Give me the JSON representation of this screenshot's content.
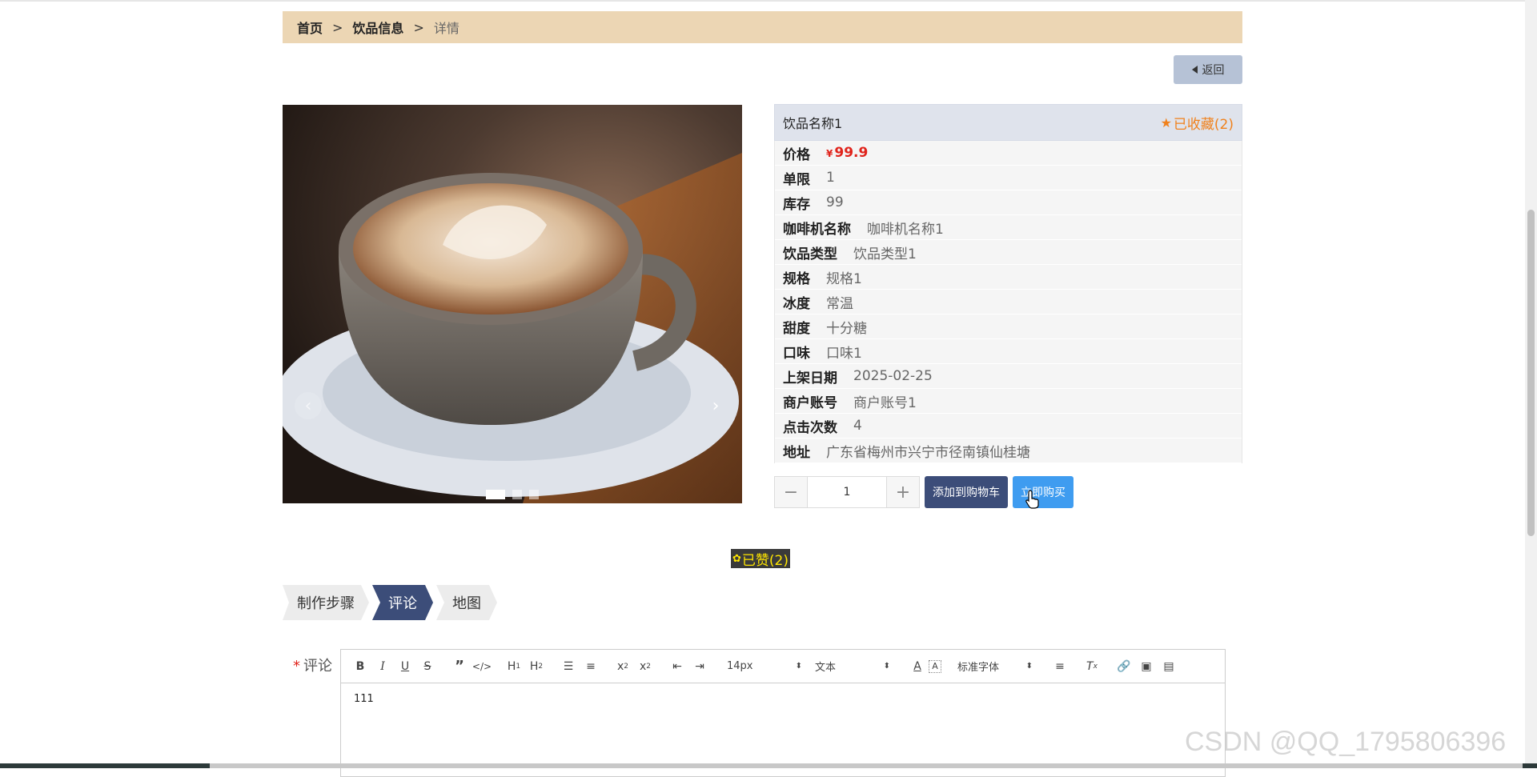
{
  "breadcrumb": {
    "home": "首页",
    "sep1": ">",
    "category": "饮品信息",
    "sep2": ">",
    "current": "详情"
  },
  "back_label": "返回",
  "product": {
    "name": "饮品名称1",
    "favorite_label": "已收藏(2)",
    "price_label": "价格",
    "currency": "¥",
    "price": "99.9",
    "details": [
      {
        "label": "单限",
        "value": "1"
      },
      {
        "label": "库存",
        "value": "99"
      },
      {
        "label": "咖啡机名称",
        "value": "咖啡机名称1"
      },
      {
        "label": "饮品类型",
        "value": "饮品类型1"
      },
      {
        "label": "规格",
        "value": "规格1"
      },
      {
        "label": "冰度",
        "value": "常温"
      },
      {
        "label": "甜度",
        "value": "十分糖"
      },
      {
        "label": "口味",
        "value": "口味1"
      },
      {
        "label": "上架日期",
        "value": "2025-02-25"
      },
      {
        "label": "商户账号",
        "value": "商户账号1"
      },
      {
        "label": "点击次数",
        "value": "4"
      },
      {
        "label": "地址",
        "value": "广东省梅州市兴宁市径南镇仙桂塘"
      }
    ]
  },
  "carousel": {
    "slide_count": 3,
    "active_index": 0,
    "prev_glyph": "‹",
    "next_glyph": "›"
  },
  "quantity": {
    "minus": "−",
    "value": "1",
    "plus": "+"
  },
  "actions": {
    "add_to_cart": "添加到购物车",
    "buy_now": "立即购买"
  },
  "liked_label": "已赞(2)",
  "tabs": [
    {
      "label": "制作步骤",
      "active": false
    },
    {
      "label": "评论",
      "active": true
    },
    {
      "label": "地图",
      "active": false
    }
  ],
  "comment": {
    "required_mark": "*",
    "label": "评论",
    "font_size": "14px",
    "text_style": "文本",
    "font_family": "标准字体",
    "content": "111"
  },
  "watermark": "CSDN @QQ_1795806396",
  "colors": {
    "breadcrumb_bg": "#ecd6b4",
    "accent_navy": "#3c4d79",
    "buy_blue": "#3f9cf0",
    "price_red": "#e0231b",
    "favorite_orange": "#f0811c"
  }
}
